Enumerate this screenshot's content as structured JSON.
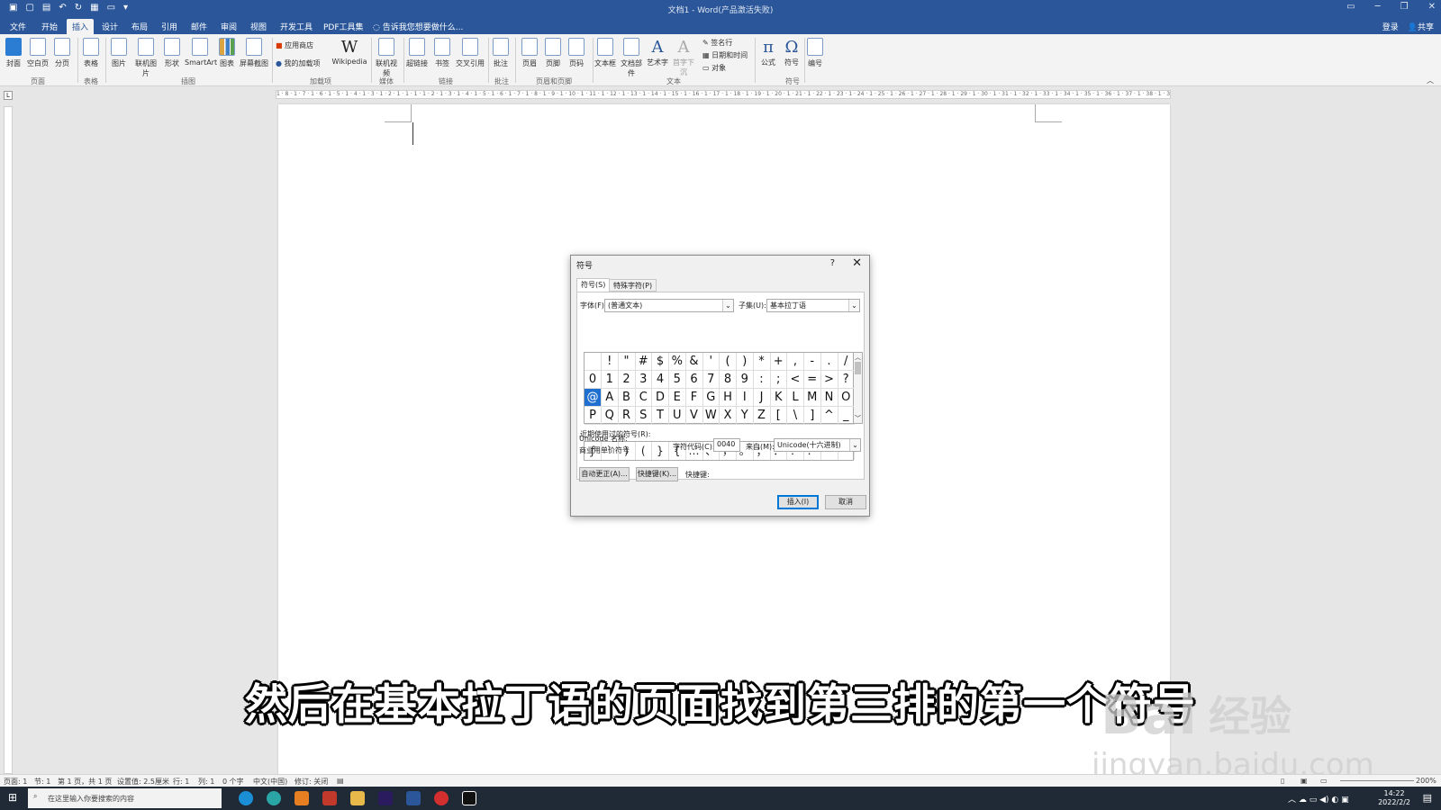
{
  "window": {
    "title": "文档1 - Word(产品激活失败)"
  },
  "tabs": [
    "文件",
    "开始",
    "插入",
    "设计",
    "布局",
    "引用",
    "邮件",
    "审阅",
    "视图",
    "开发工具",
    "PDF工具集"
  ],
  "tell_me": "告诉我您想要做什么...",
  "account": {
    "login": "登录",
    "share": "共享"
  },
  "ribbon": {
    "buttons": [
      "封面",
      "空白页",
      "分页",
      "表格",
      "图片",
      "联机图片",
      "形状",
      "SmartArt",
      "图表",
      "屏幕截图",
      "Wikipedia",
      "联机视频",
      "超链接",
      "书签",
      "交叉引用",
      "批注",
      "页眉",
      "页脚",
      "页码",
      "文本框",
      "文档部件",
      "艺术字",
      "首字下沉",
      "公式",
      "符号",
      "编号"
    ],
    "small": {
      "store": "应用商店",
      "addins": "我的加载项",
      "signature": "签名行",
      "datetime": "日期和时间",
      "object": "对象"
    },
    "groups": [
      "页面",
      "表格",
      "插图",
      "加载项",
      "媒体",
      "链接",
      "批注",
      "页眉和页脚",
      "文本",
      "符号"
    ]
  },
  "ruler": {
    "ticks": "1 · 8 · 1 · 7 · 1 · 6 · 1 · 5 · 1 · 4 · 1 · 3 · 1 · 2 · 1 · 1 · 1 · 1 · 2 · 1 · 3 · 1 · 4 · 1 · 5 · 1 · 6 · 1 · 7 · 1 · 8 · 1 · 9 · 1 · 10 · 1 · 11 · 1 · 12 · 1 · 13 · 1 · 14 · 1 · 15 · 1 · 16 · 1 · 17 · 1 · 18 · 1 · 19 · 1 · 20 · 1 · 21 · 1 · 22 · 1 · 23 · 1 · 24 · 1 · 25 · 1 · 26 · 1 · 27 · 1 · 28 · 1 · 29 · 1 · 30 · 1 · 31 · 1 · 32 · 1 · 33 · 1 · 34 · 1 · 35 · 1 · 36 · 1 · 37 · 1 · 38 · 1 · 39 · 1 · 40 · 1 · 41 · 1 · 42 · 1 · 43 · 1 · 44 · 1 · 45 · 1 · 46 · 1 · 47 · 1 · 48"
  },
  "dialog": {
    "title": "符号",
    "help": "?",
    "close": "✕",
    "tab_symbols": "符号(S)",
    "tab_special": "特殊字符(P)",
    "font_label": "字体(F):",
    "font_value": "(普通文本)",
    "subset_label": "子集(U):",
    "subset_value": "基本拉丁语",
    "symbols": [
      " ",
      "!",
      "\"",
      "#",
      "$",
      "%",
      "&",
      "'",
      "(",
      ")",
      "*",
      "+",
      ",",
      "-",
      ".",
      "/",
      "0",
      "1",
      "2",
      "3",
      "4",
      "5",
      "6",
      "7",
      "8",
      "9",
      ":",
      ";",
      "<",
      "=",
      ">",
      "?",
      "@",
      "A",
      "B",
      "C",
      "D",
      "E",
      "F",
      "G",
      "H",
      "I",
      "J",
      "K",
      "L",
      "M",
      "N",
      "O",
      "P",
      "Q",
      "R",
      "S",
      "T",
      "U",
      "V",
      "W",
      "X",
      "Y",
      "Z",
      "[",
      "\\",
      "]",
      "^",
      "_"
    ],
    "selected_index": 32,
    "recent_label": "近期使用过的符号(R):",
    "recent": [
      "ƒ",
      "`",
      ")",
      "(",
      "}",
      "{",
      "…",
      "、",
      "，",
      "。",
      "；",
      "：",
      "！",
      "？",
      "“",
      "”"
    ],
    "unicode_name_label": "Unicode 名称:",
    "unicode_name": "商业用单价符号",
    "char_code_label": "字符代码(C):",
    "char_code": "0040",
    "from_label": "来自(M):",
    "from_value": "Unicode(十六进制)",
    "autocorrect": "自动更正(A)...",
    "shortcut_key_btn": "快捷键(K)...",
    "shortcut_label": "快捷键:",
    "insert": "插入(I)",
    "cancel": "取消"
  },
  "caption": "然后在基本拉丁语的页面找到第三排的第一个符号",
  "watermark": {
    "brand": "Bai",
    "jingyan": "经验",
    "url": "jingyan.baidu.com"
  },
  "status": {
    "page": "页面: 1",
    "section": "节: 1",
    "pages": "第 1 页，共 1 页",
    "position": "设置值: 2.5厘米",
    "line": "行: 1",
    "col": "列: 1",
    "words": "0 个字",
    "lang": "中文(中国)",
    "track": "修订: 关闭",
    "zoom": "200%"
  },
  "taskbar": {
    "search": "在这里输入你要搜索的内容",
    "time": "14:22",
    "date": "2022/2/2"
  }
}
